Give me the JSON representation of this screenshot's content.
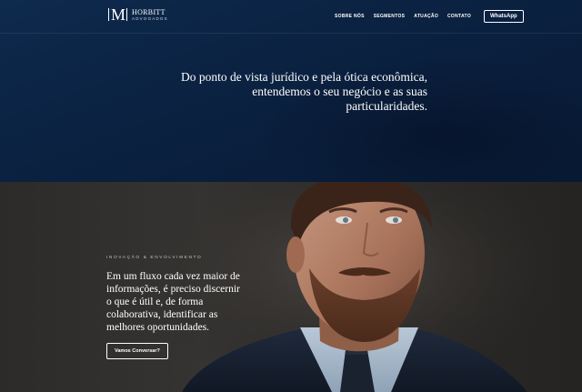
{
  "header": {
    "logo": {
      "mark": "M",
      "name": "HORBITT",
      "subtitle": "ADVOGADOS"
    },
    "nav": [
      "Sobre nós",
      "Segmentos",
      "Atuação",
      "Contato"
    ],
    "whatsapp_label": "WhatsApp"
  },
  "hero": {
    "quote_lines": [
      "Do ponto de vista jurídico e pela ótica econômica,",
      "entendemos o seu negócio e as suas",
      "particularidades."
    ]
  },
  "innovation": {
    "tagline": "Inovação & Envolvimento",
    "text_lines": [
      "Em um fluxo cada vez maior de",
      "informações, é preciso discernir",
      "o que é útil e, de forma",
      "colaborativa, identificar as",
      "melhores oportunidades."
    ],
    "cta_label": "Vamos Conversar?"
  },
  "colors": {
    "navy": "#0b2242",
    "dark_bg": "#2f2d2b",
    "text": "#ffffff"
  }
}
